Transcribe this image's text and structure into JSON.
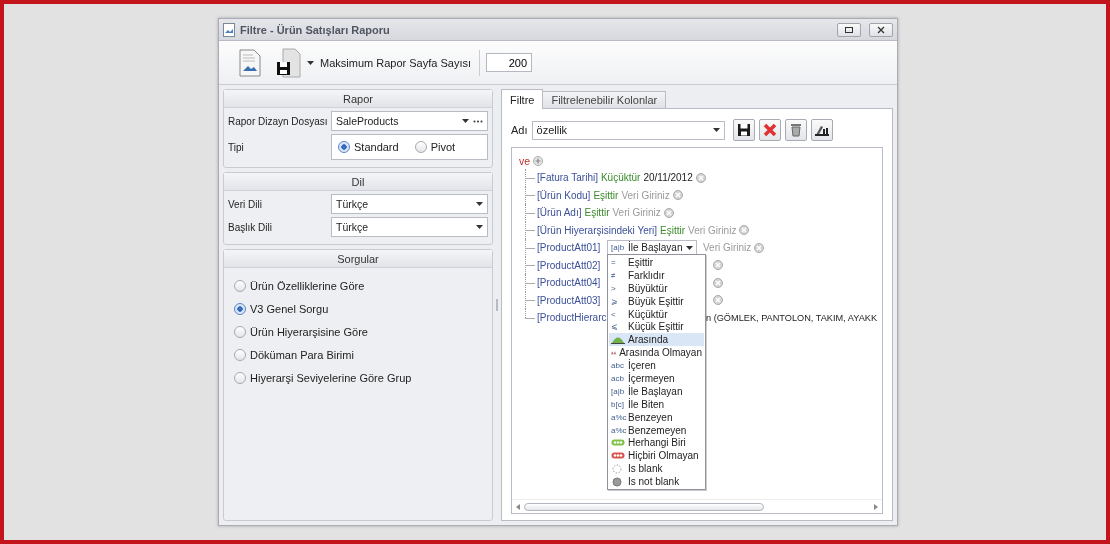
{
  "window": {
    "title": "Filtre - Ürün Satışları Raporu"
  },
  "toolbar": {
    "label": "Maksimum Rapor Sayfa Sayısı",
    "value": "200"
  },
  "rapor": {
    "title": "Rapor",
    "design_file": {
      "label": "Rapor Dizayn Dosyası",
      "value": "SaleProducts"
    },
    "type": {
      "label": "Tipi",
      "options": [
        {
          "label": "Standard",
          "selected": true
        },
        {
          "label": "Pivot",
          "selected": false
        }
      ]
    }
  },
  "dil": {
    "title": "Dil",
    "fields": [
      {
        "label": "Veri Dili",
        "value": "Türkçe"
      },
      {
        "label": "Başlık Dili",
        "value": "Türkçe"
      }
    ]
  },
  "sorgular": {
    "title": "Sorgular",
    "options": [
      {
        "label": "Ürün Özelliklerine Göre",
        "selected": false
      },
      {
        "label": "V3 Genel Sorgu",
        "selected": true
      },
      {
        "label": "Ürün Hiyerarşisine Göre",
        "selected": false
      },
      {
        "label": "Döküman Para Birimi",
        "selected": false
      },
      {
        "label": "Hiyerarşi Seviyelerine Göre Grup",
        "selected": false
      }
    ]
  },
  "tabs": [
    {
      "label": "Filtre",
      "selected": true
    },
    {
      "label": "Filtrelenebilir Kolonlar",
      "selected": false
    }
  ],
  "filter": {
    "name_label": "Adı",
    "name_value": "özellik",
    "root": "ve",
    "rows": [
      {
        "kind": "condition",
        "field": "[Fatura Tarihi]",
        "operator": "Küçüktür",
        "value": "20/11/2012",
        "removable": true
      },
      {
        "kind": "condition",
        "field": "[Ürün Kodu]",
        "operator": "Eşittir",
        "placeholder": "Veri Giriniz",
        "removable": true
      },
      {
        "kind": "condition",
        "field": "[Ürün Adı]",
        "operator": "Eşittir",
        "placeholder": "Veri Giriniz",
        "removable": true
      },
      {
        "kind": "condition",
        "field": "[Ürün Hiyerarşisindeki Yeri]",
        "operator": "Eşittir",
        "placeholder": "Veri Giriniz",
        "removable": true
      },
      {
        "kind": "dropdown",
        "field": "[ProductAtt01]",
        "symbol": "[a|b",
        "operator": "İle Başlayan",
        "placeholder": "Veri Giriniz",
        "removable": true
      },
      {
        "kind": "covered",
        "field": "[ProductAtt02]",
        "removable": true
      },
      {
        "kind": "covered",
        "field": "[ProductAtt04]",
        "removable": true
      },
      {
        "kind": "covered",
        "field": "[ProductAtt03]",
        "removable": true
      },
      {
        "kind": "covered",
        "field": "[ProductHierarc",
        "tail": "n (GÖMLEK, PANTOLON, TAKIM, AYAKK",
        "removable": false
      }
    ]
  },
  "operator_menu": {
    "items": [
      {
        "kind": "glyph",
        "symbol": "=",
        "label": "Eşittir",
        "selected": false
      },
      {
        "kind": "glyph",
        "symbol": "≠",
        "label": "Farklıdır",
        "selected": false
      },
      {
        "kind": "glyph",
        "symbol": ">",
        "label": "Büyüktür",
        "selected": false
      },
      {
        "kind": "glyph",
        "symbol": "⩾",
        "label": "Büyük Eşittir",
        "selected": false
      },
      {
        "kind": "glyph",
        "symbol": "<",
        "label": "Küçüktür",
        "selected": false
      },
      {
        "kind": "glyph",
        "symbol": "⩽",
        "label": "Küçük Eşittir",
        "selected": false
      },
      {
        "kind": "between",
        "label": "Arasında",
        "selected": true
      },
      {
        "kind": "not_between",
        "label": "Arasında Olmayan",
        "selected": false
      },
      {
        "kind": "glyph",
        "symbol": "abc",
        "label": "İçeren",
        "selected": false
      },
      {
        "kind": "glyph",
        "symbol": "acb",
        "label": "İçermeyen",
        "selected": false
      },
      {
        "kind": "glyph",
        "symbol": "[a|b",
        "label": "İle Başlayan",
        "selected": false
      },
      {
        "kind": "glyph",
        "symbol": "b[c]",
        "label": "İle Biten",
        "selected": false
      },
      {
        "kind": "glyph",
        "symbol": "a%c",
        "label": "Benzeyen",
        "selected": false
      },
      {
        "kind": "glyph",
        "symbol": "a%c",
        "label": "Benzemeyen",
        "selected": false
      },
      {
        "kind": "any_of",
        "label": "Herhangi Biri",
        "selected": false
      },
      {
        "kind": "none_of",
        "label": "Hiçbiri Olmayan",
        "selected": false
      },
      {
        "kind": "blank",
        "label": "Is blank",
        "selected": false
      },
      {
        "kind": "not_blank",
        "label": "Is not blank",
        "selected": false
      }
    ]
  }
}
